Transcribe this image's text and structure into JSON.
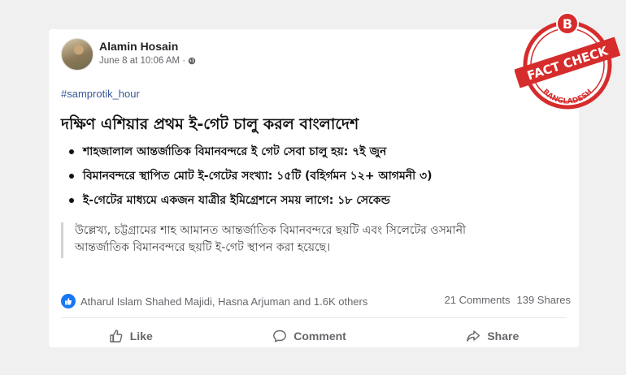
{
  "post": {
    "author": "Alamin Hosain",
    "timestamp": "June 8 at 10:06 AM ·",
    "hashtag": "#samprotik_hour",
    "headline": "দক্ষিণ এশিয়ার প্রথম ই-গেট চালু করল বাংলাদেশ",
    "bullets": [
      "শাহজালাল আন্তর্জাতিক বিমানবন্দরে ই গেট সেবা চালু হয়: ৭ই জুন",
      "বিমানবন্দরে স্থাপিত মোট ই-গেটের সংখ্যা: ১৫টি (বহির্গমন ১২+ আগমনী ৩)",
      "ই-গেটের মাধ্যমে একজন যাত্রীর ইমিগ্রেশনে সময় লাগে: ১৮ সেকেন্ড"
    ],
    "quote_line1": "উল্লেখ্য, চট্টগ্রামের শাহ আমানত আন্তর্জাতিক বিমানবন্দরে ছয়টি এবং সিলেটের ওসমানী",
    "quote_line2": "আন্তর্জাতিক বিমানবন্দরে ছয়টি ই-গেট স্থাপন করা হয়েছে।"
  },
  "engagement": {
    "reactions_text": "Atharul Islam Shahed Majidi, Hasna Arjuman and 1.6K others",
    "comments": "21 Comments",
    "shares": "139 Shares"
  },
  "actions": {
    "like": "Like",
    "comment": "Comment",
    "share": "Share"
  },
  "badge": {
    "letter": "B",
    "label": "FACT CHECK",
    "country": "BANGLADESH",
    "color": "#d62c2c"
  }
}
